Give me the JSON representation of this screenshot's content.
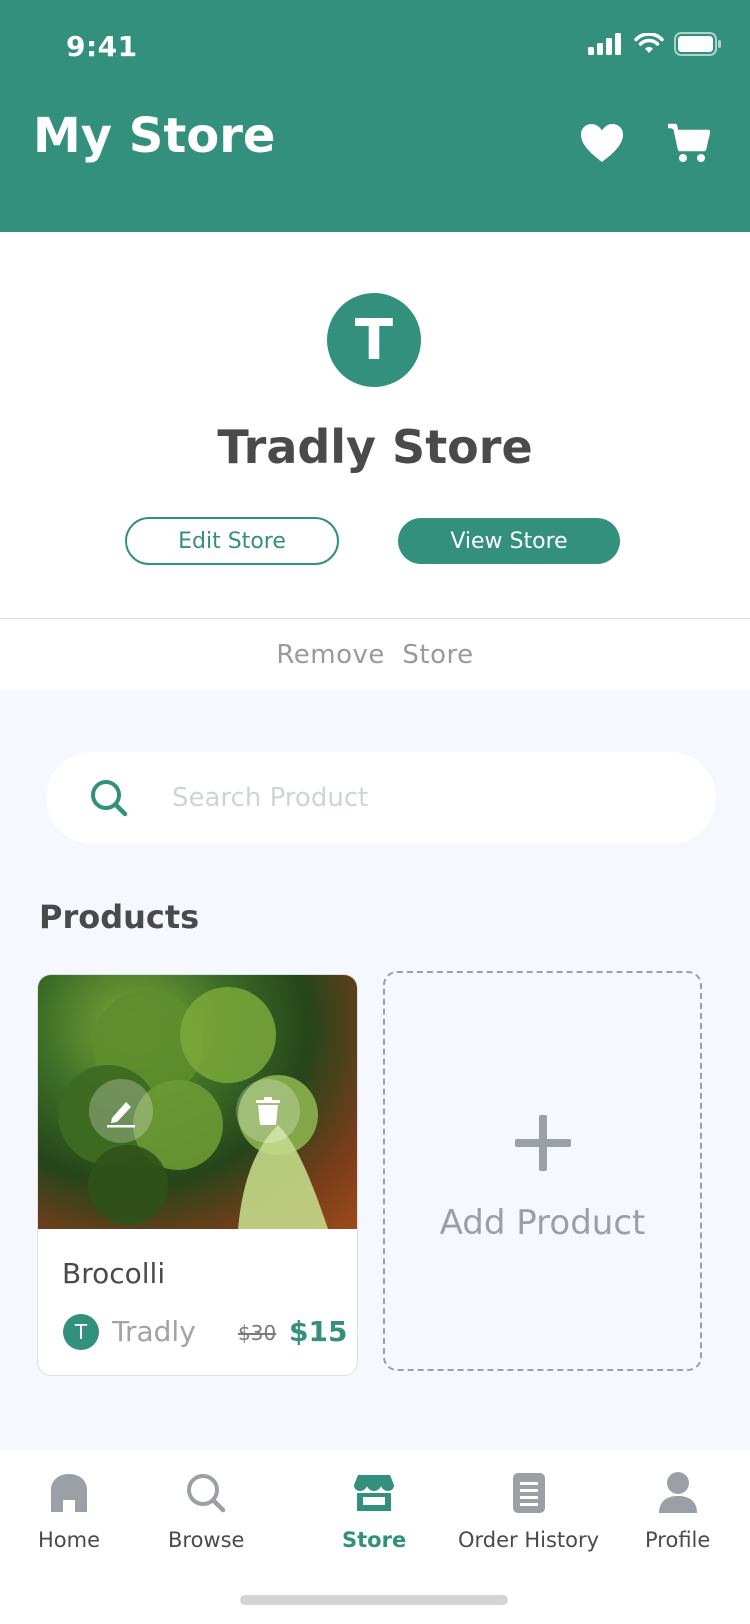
{
  "status_bar": {
    "time": "9:41"
  },
  "header": {
    "title": "My Store"
  },
  "store": {
    "avatar_letter": "T",
    "name": "Tradly Store",
    "edit_label": "Edit Store",
    "view_label": "View Store",
    "remove_label": "Remove  Store"
  },
  "search": {
    "placeholder": "Search Product"
  },
  "products": {
    "title": "Products",
    "items": [
      {
        "name": "Brocolli",
        "seller_letter": "T",
        "seller": "Tradly",
        "old_price": "$30",
        "price": "$15"
      }
    ],
    "add_label": "Add Product"
  },
  "tabbar": {
    "items": [
      {
        "label": "Home",
        "icon": "home-icon"
      },
      {
        "label": "Browse",
        "icon": "search-icon"
      },
      {
        "label": "Store",
        "icon": "store-icon",
        "active": true
      },
      {
        "label": "Order History",
        "icon": "order-history-icon"
      },
      {
        "label": "Profile",
        "icon": "profile-icon"
      }
    ]
  },
  "colors": {
    "primary": "#33907c",
    "background": "#f5f8fe"
  }
}
